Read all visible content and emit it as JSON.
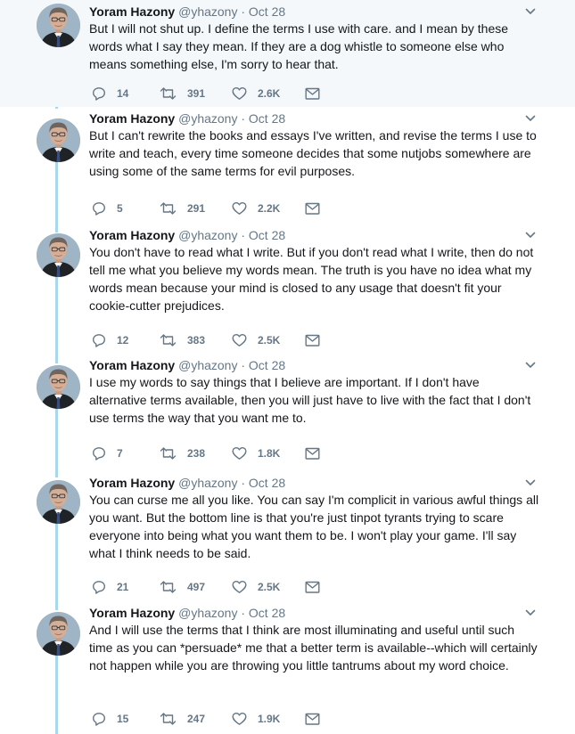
{
  "thread": {
    "author": {
      "name": "Yoram Hazony",
      "handle": "@yhazony",
      "separator": "·"
    },
    "tweets": [
      {
        "date": "Oct 28",
        "text": "But I will not shut up. I define the terms I use with care. and I mean by these words what I say they mean. If they are a dog whistle to someone else who means something else, I'm sorry to hear that.",
        "replies": "14",
        "retweets": "391",
        "likes": "2.6K"
      },
      {
        "date": "Oct 28",
        "text": "But I can't rewrite the books and essays I've written, and revise the terms I use to write and teach, every time someone decides that some nutjobs somewhere are using some of the same terms for evil purposes.",
        "replies": "5",
        "retweets": "291",
        "likes": "2.2K"
      },
      {
        "date": "Oct 28",
        "text": "You don't have to read what I write. But if you don't read what I write, then do not tell me what you believe my words mean. The truth is you have no idea what my words mean because your mind is closed to any usage that doesn't fit your cookie-cutter prejudices.",
        "replies": "12",
        "retweets": "383",
        "likes": "2.5K"
      },
      {
        "date": "Oct 28",
        "text": "I use my words to say things that I believe are important. If I don't have alternative terms available, then you will just have to live with the fact that I don't use terms the way that you want me to.",
        "replies": "7",
        "retweets": "238",
        "likes": "1.8K"
      },
      {
        "date": "Oct 28",
        "text": "You can curse me all you like. You can say I'm complicit in various awful things all you want. But the bottom line is that you're just tinpot tyrants trying to scare everyone into being what you want them to be. I won't play your game. I'll say what I think needs to be said.",
        "replies": "21",
        "retweets": "497",
        "likes": "2.5K"
      },
      {
        "date": "Oct 28",
        "text": "And I will use the terms that I think are most illuminating and useful until such time as you can *persuade* me that a better term is available--which will certainly not happen while you are throwing you little tantrums about my word choice.",
        "replies": "15",
        "retweets": "247",
        "likes": "1.9K"
      }
    ]
  },
  "icons": {
    "reply": "reply-icon",
    "retweet": "retweet-icon",
    "like": "heart-icon",
    "message": "envelope-icon",
    "caret": "chevron-down-icon",
    "avatar": "avatar"
  },
  "colors": {
    "thread_line": "#a8d8ee",
    "meta": "#657786",
    "highlight_bg": "#f5f8fa"
  }
}
